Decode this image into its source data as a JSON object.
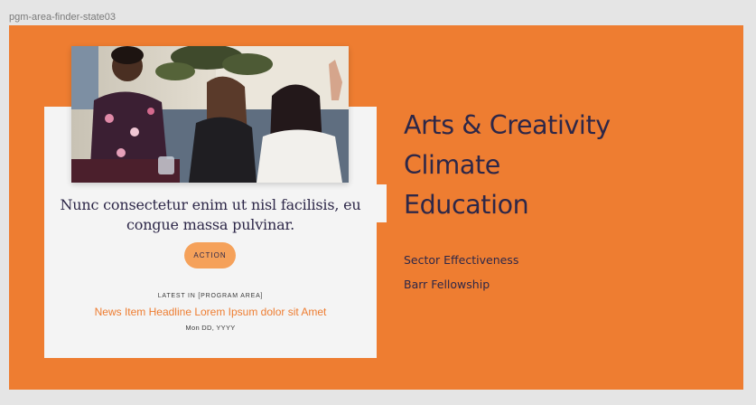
{
  "frame": {
    "label": "pgm-area-finder-state03",
    "background_color": "#ee7d31"
  },
  "card": {
    "image": {
      "description_icon": "photo-of-smiling-women"
    },
    "quote": "Nunc consectetur enim ut nisl facilisis, eu congue massa pulvinar.",
    "action_label": "ACTION",
    "action_color": "#f5a15a",
    "latest_label": "LATEST IN [PROGRAM AREA]",
    "news_headline": "News Item Headline Lorem Ipsum dolor sit Amet",
    "news_date": "Mon DD, YYYY",
    "headline_color": "#ee7d31"
  },
  "programs": [
    {
      "label": "Arts & Creativity"
    },
    {
      "label": "Climate"
    },
    {
      "label": "Education"
    }
  ],
  "secondary": [
    {
      "label": "Sector Effectiveness"
    },
    {
      "label": "Barr Fellowship"
    }
  ],
  "text_color": "#2d2748"
}
